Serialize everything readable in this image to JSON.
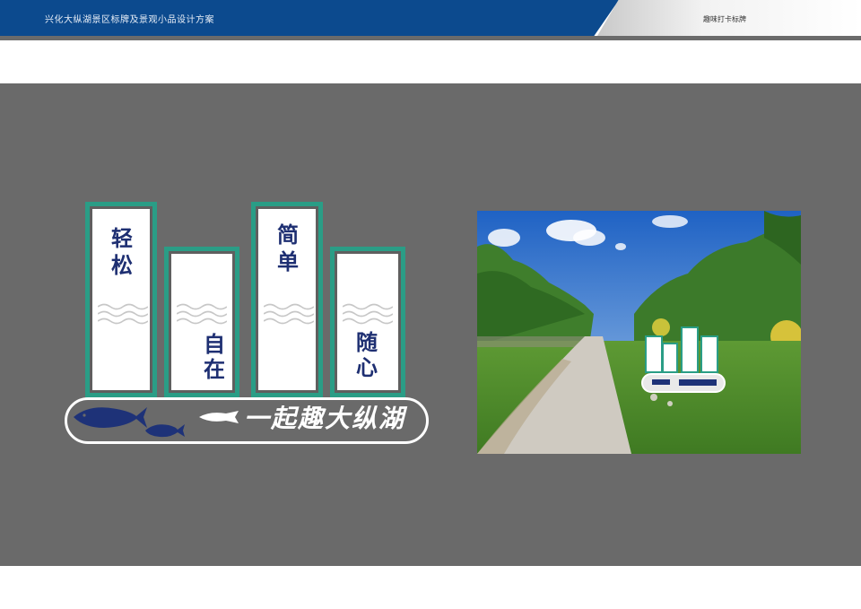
{
  "header": {
    "doc_title": "兴化大纵湖景区标牌及景观小品设计方案",
    "section_title": "趣味打卡标牌"
  },
  "design": {
    "boards": [
      {
        "text_top": "轻",
        "text_bottom": "松"
      },
      {
        "text_top": "自",
        "text_bottom": "在"
      },
      {
        "text_top": "简",
        "text_bottom": "单"
      },
      {
        "text_top": "随",
        "text_bottom": "心"
      }
    ],
    "slogan": "一起趣大纵湖"
  },
  "colors": {
    "header_blue": "#0c4a8e",
    "panel_grey": "#6a6a6a",
    "frame_green": "#2a9d86",
    "glyph_navy": "#1e2f72"
  }
}
